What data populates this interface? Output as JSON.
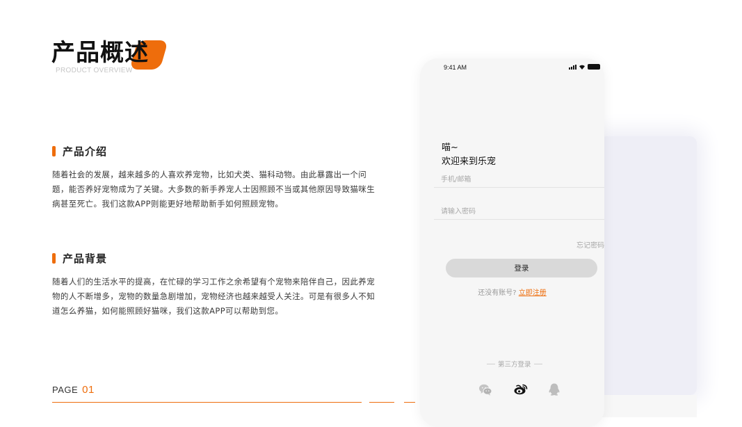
{
  "slide": {
    "title": "产品概述",
    "subtitle": "PRODUCT OVERVIEW",
    "accent_color": "#ee6d0c"
  },
  "sections": [
    {
      "heading": "产品介绍",
      "body": "随着社会的发展，越来越多的人喜欢养宠物，比如犬类、猫科动物。由此暴露出一个问题，能否养好宠物成为了关键。大多数的新手养宠人士因照顾不当或其他原因导致猫咪生病甚至死亡。我们这款APP则能更好地帮助新手如何照顾宠物。"
    },
    {
      "heading": "产品背景",
      "body": "随着人们的生活水平的提高，在忙碌的学习工作之余希望有个宠物来陪伴自己，因此养宠物的人不断增多，宠物的数量急剧增加，宠物经济也越来越受人关注。可是有很多人不知道怎么养猫，如何能照顾好猫咪，我们这款APP可以帮助到您。"
    }
  ],
  "footer": {
    "page_label": "PAGE",
    "page_number": "01"
  },
  "phone": {
    "status_time": "9:41 AM",
    "greeting_line1": "喵~",
    "greeting_line2": "欢迎来到乐宠",
    "username_placeholder": "手机/邮箱",
    "password_placeholder": "请输入密码",
    "forgot_label": "忘记密码",
    "login_label": "登录",
    "register_prompt": "还没有账号?",
    "register_link": "立即注册",
    "third_party_label": "第三方登录",
    "social_icons": [
      "wechat-icon",
      "weibo-icon",
      "qq-icon"
    ]
  }
}
